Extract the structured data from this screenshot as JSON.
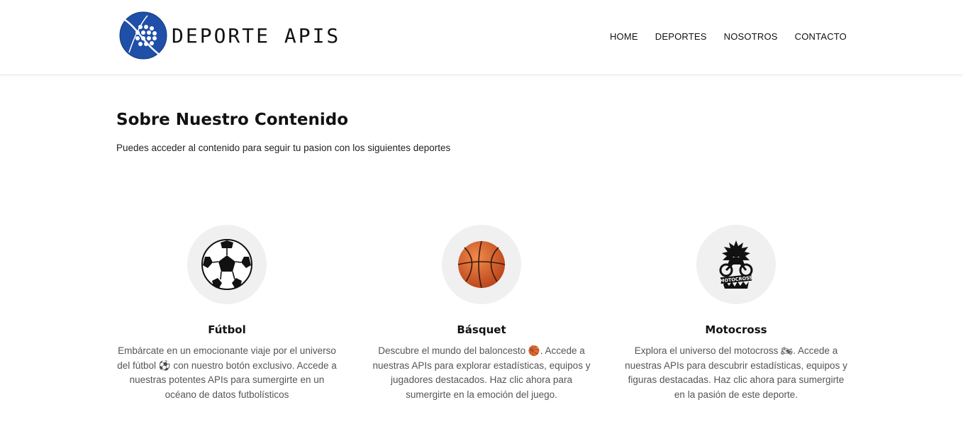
{
  "brand": {
    "name": "DEPORTE APIS"
  },
  "nav": {
    "items": [
      {
        "label": "HOME"
      },
      {
        "label": "DEPORTES"
      },
      {
        "label": "NOSOTROS"
      },
      {
        "label": "CONTACTO"
      }
    ]
  },
  "intro": {
    "title": "Sobre Nuestro Contenido",
    "subtitle": "Puedes acceder al contenido para seguir tu pasion con los siguientes deportes"
  },
  "cards": [
    {
      "icon": "soccer-ball-icon",
      "title": "Fútbol",
      "description": "Embárcate en un emocionante viaje por el universo del fútbol ⚽ con nuestro botón exclusivo. Accede a nuestras potentes APIs para sumergirte en un océano de datos futbolísticos"
    },
    {
      "icon": "basketball-icon",
      "title": "Básquet",
      "description": "Descubre el mundo del baloncesto 🏀. Accede a nuestras APIs para explorar estadísticas, equipos y jugadores destacados. Haz clic ahora para sumergirte en la emoción del juego."
    },
    {
      "icon": "motocross-icon",
      "title": "Motocross",
      "description": "Explora el universo del motocross 🏍. Accede a nuestras APIs para descubrir estadísticas, equipos y figuras destacadas. Haz clic ahora para sumergirte en la pasión de este deporte."
    }
  ],
  "colors": {
    "logo_blue": "#1f4fa8",
    "icon_bg": "#f0f0f0",
    "basketball": "#d9531e"
  }
}
